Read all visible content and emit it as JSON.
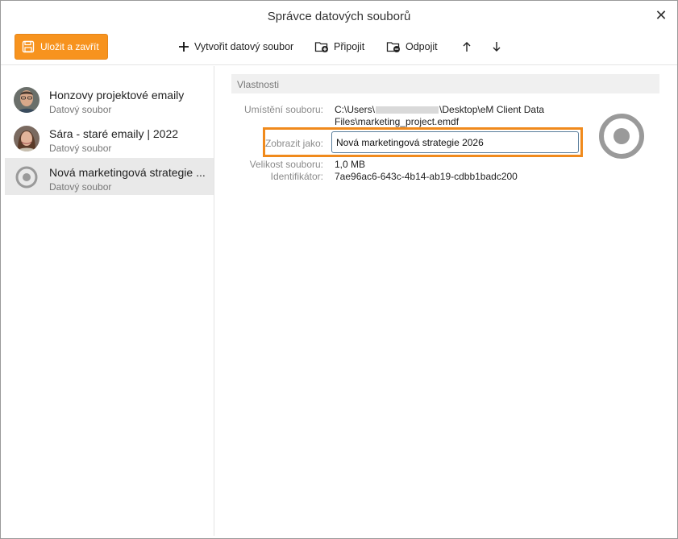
{
  "window": {
    "title": "Správce datových souborů"
  },
  "toolbar": {
    "save_label": "Uložit a zavřít",
    "create_label": "Vytvořit datový soubor",
    "attach_label": "Připojit",
    "detach_label": "Odpojit",
    "accent": "#f7931e"
  },
  "sidebar": {
    "items": [
      {
        "name": "Honzovy projektové emaily",
        "sub": "Datový soubor",
        "icon": "avatar-man"
      },
      {
        "name": "Sára - staré emaily | 2022",
        "sub": "Datový soubor",
        "icon": "avatar-woman"
      },
      {
        "name": "Nová marketingová strategie ...",
        "sub": "Datový soubor",
        "icon": "target-icon"
      }
    ]
  },
  "properties": {
    "header": "Vlastnosti",
    "location_label": "Umístění souboru:",
    "location_prefix": "C:\\Users\\",
    "location_suffix": "\\Desktop\\eM Client Data",
    "location_line2": "Files\\marketing_project.emdf",
    "display_label": "Zobrazit jako:",
    "display_value": "Nová marketingová strategie 2026",
    "size_label": "Velikost souboru:",
    "size_value": "1,0 MB",
    "id_label": "Identifikátor:",
    "id_value": "7ae96ac6-643c-4b14-ab19-cdbb1badc200"
  }
}
